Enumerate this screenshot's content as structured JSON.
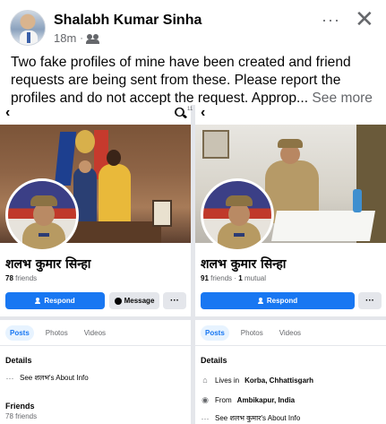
{
  "post": {
    "author": "Shalabh Kumar Sinha",
    "time": "18m",
    "separator": "·",
    "text": "Two fake profiles of mine have been created and friend requests are being sent from these. Please report the profiles and do not accept the request. Approp...",
    "see_more": "See more",
    "more_glyph": "···",
    "close_glyph": "✕"
  },
  "left_profile": {
    "name": "शलभ कुमार सिन्हा",
    "friends_count": "78",
    "friends_label": "friends",
    "respond_label": "Respond",
    "message_label": "Message",
    "more_label": "···",
    "tabs": [
      "Posts",
      "Photos",
      "Videos"
    ],
    "details_title": "Details",
    "about_row": "See शलभ's About Info",
    "friends_title": "Friends",
    "friends_sub": "78 friends"
  },
  "right_profile": {
    "name": "शलभ कुमार सिन्हा",
    "friends_count": "91",
    "friends_label": "friends",
    "mutual_count": "1",
    "mutual_label": "mutual",
    "respond_label": "Respond",
    "more_label": "···",
    "tabs": [
      "Posts",
      "Photos",
      "Videos"
    ],
    "details_title": "Details",
    "lives_prefix": "Lives in",
    "lives_place": "Korba, Chhattisgarh",
    "from_prefix": "From",
    "from_place": "Ambikapur, India",
    "about_row": "See शलभ कुमार's About Info",
    "tiny_count": "11"
  },
  "icons": {
    "back": "chevron-left-icon",
    "search": "search-icon",
    "home": "home-icon",
    "pin": "location-pin-icon",
    "ellipsis": "ellipsis-icon"
  },
  "colors": {
    "primary": "#1877f2",
    "secondary_bg": "#e4e6eb",
    "muted_text": "#65676b"
  }
}
